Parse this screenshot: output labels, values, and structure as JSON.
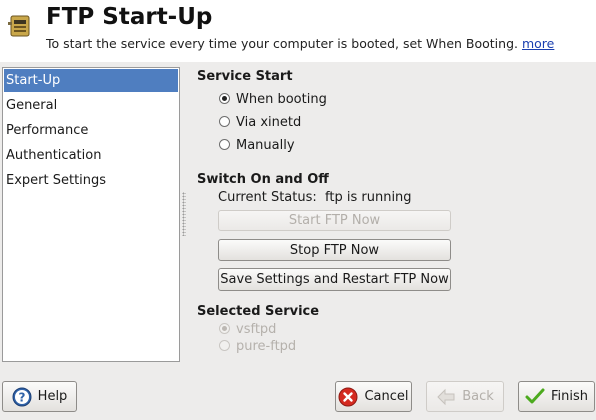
{
  "header": {
    "title": "FTP Start-Up",
    "subtitle": "To start the service every time your computer is booted, set When Booting.",
    "more_link": "more",
    "icon": "ftp-server-icon"
  },
  "sidebar": {
    "items": [
      {
        "label": "Start-Up",
        "selected": true
      },
      {
        "label": "General",
        "selected": false
      },
      {
        "label": "Performance",
        "selected": false
      },
      {
        "label": "Authentication",
        "selected": false
      },
      {
        "label": "Expert Settings",
        "selected": false
      }
    ]
  },
  "service_start": {
    "title": "Service Start",
    "options": [
      {
        "label": "When booting",
        "checked": true
      },
      {
        "label": "Via xinetd",
        "checked": false
      },
      {
        "label": "Manually",
        "checked": false
      }
    ]
  },
  "switch": {
    "title": "Switch On and Off",
    "status_label": "Current Status:",
    "status_value": "ftp is running",
    "start_button": "Start FTP Now",
    "stop_button": "Stop FTP Now",
    "save_restart_button": "Save Settings and Restart FTP Now"
  },
  "selected_service": {
    "title": "Selected Service",
    "options": [
      {
        "label": "vsftpd",
        "checked": true,
        "disabled": true
      },
      {
        "label": "pure-ftpd",
        "checked": false,
        "disabled": true
      }
    ]
  },
  "footer": {
    "help": "Help",
    "cancel": "Cancel",
    "back": "Back",
    "finish": "Finish"
  },
  "colors": {
    "selection": "#4f7ec0",
    "link": "#1a3fb0",
    "cancel_icon": "#d42a20",
    "finish_icon": "#4caa1e",
    "help_icon": "#2f62a8"
  }
}
